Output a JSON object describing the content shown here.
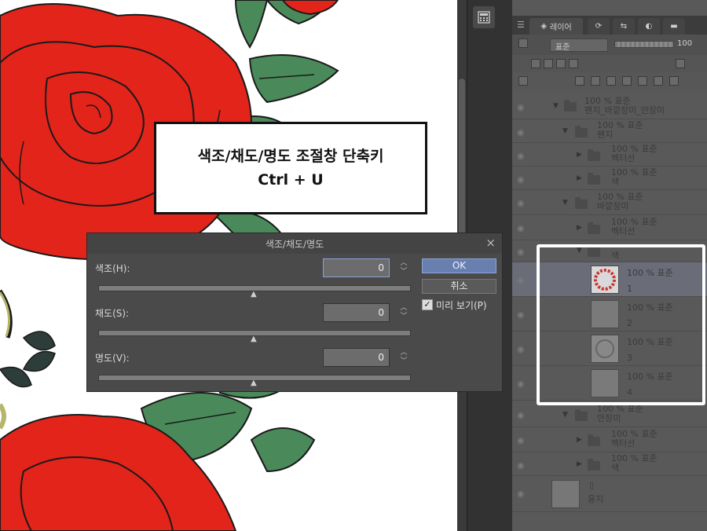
{
  "annotation": {
    "line1": "색조/채도/명도 조절창 단축키",
    "line2": "Ctrl + U"
  },
  "dialog": {
    "title": "색조/채도/명도",
    "close": "×",
    "fields": [
      {
        "label": "색조(H):",
        "value": "0"
      },
      {
        "label": "채도(S):",
        "value": "0"
      },
      {
        "label": "명도(V):",
        "value": "0"
      }
    ],
    "ok": "OK",
    "cancel": "취소",
    "preview_label": "미리 보기(P)",
    "preview_checked": "✓"
  },
  "layer_panel": {
    "tab_label": "레이어",
    "blend_mode": "표준",
    "opacity": "100",
    "layers": [
      {
        "name": "팬지_바깥장미_안장미",
        "mode": "100 % 표준"
      },
      {
        "name": "팬지",
        "mode": "100 % 표준"
      },
      {
        "name": "벡터선",
        "mode": "100 % 표준"
      },
      {
        "name": "색",
        "mode": "100 % 표준"
      },
      {
        "name": "바깥장미",
        "mode": "100 % 표준"
      },
      {
        "name": "벡터선",
        "mode": "100 % 표준"
      },
      {
        "name": "색",
        "mode": ""
      },
      {
        "name": "1",
        "mode": "100 % 표준"
      },
      {
        "name": "2",
        "mode": "100 % 표준"
      },
      {
        "name": "3",
        "mode": "100 % 표준"
      },
      {
        "name": "4",
        "mode": "100 % 표준"
      },
      {
        "name": "안장미",
        "mode": "100 % 표준"
      },
      {
        "name": "벡터선",
        "mode": "100 % 표준"
      },
      {
        "name": "색",
        "mode": "100 % 표준"
      },
      {
        "name": "용지",
        "mode": ""
      }
    ]
  },
  "colors": {
    "rose": "#e2241a",
    "leaf": "#4a8a5a",
    "accent": "#6880b0"
  }
}
